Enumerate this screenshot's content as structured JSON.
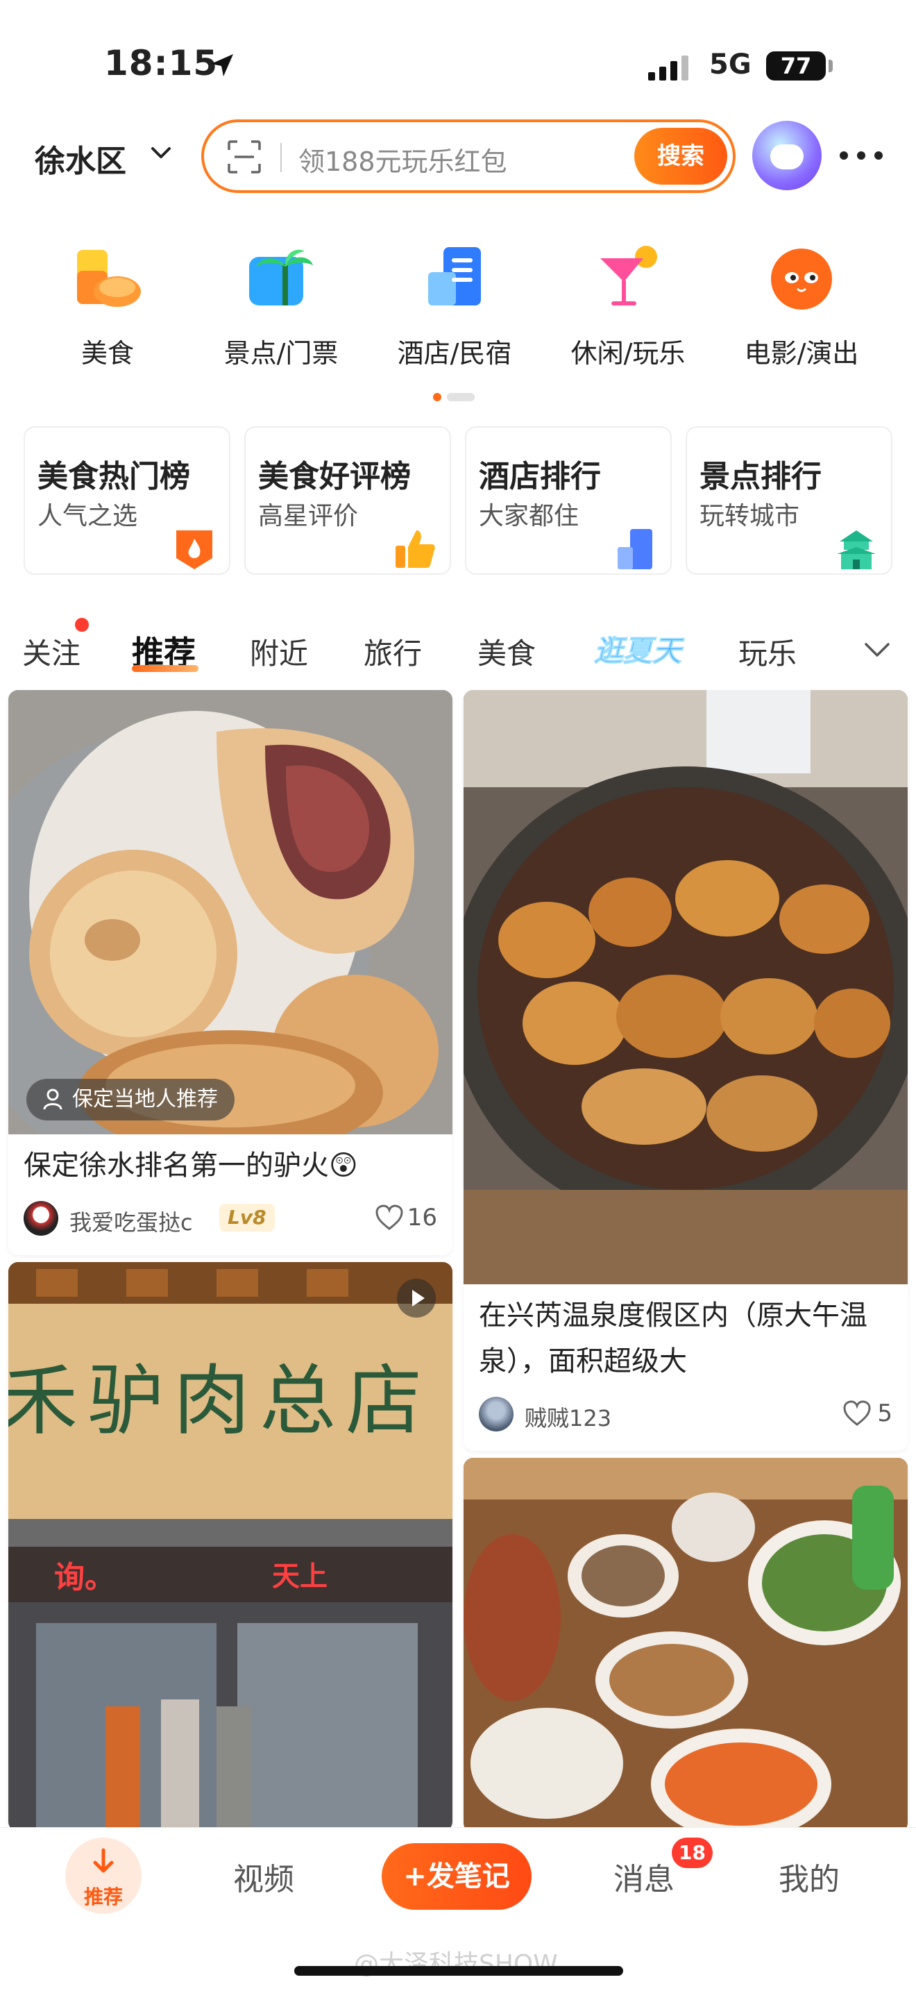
{
  "status_bar": {
    "time": "18:15",
    "network": "5G",
    "battery": "77"
  },
  "header": {
    "district": "徐水区",
    "search_placeholder": "领188元玩乐红包",
    "search_button": "搜索"
  },
  "categories": [
    {
      "label": "美食",
      "icon": "food-icon"
    },
    {
      "label": "景点/门票",
      "icon": "scenic-icon"
    },
    {
      "label": "酒店/民宿",
      "icon": "hotel-icon"
    },
    {
      "label": "休闲/玩乐",
      "icon": "cocktail-icon"
    },
    {
      "label": "电影/演出",
      "icon": "cat-movie-icon"
    }
  ],
  "rankings": [
    {
      "title": "美食热门榜",
      "subtitle": "人气之选",
      "icon": "flame-icon"
    },
    {
      "title": "美食好评榜",
      "subtitle": "高星评价",
      "icon": "thumbs-up-icon"
    },
    {
      "title": "酒店排行",
      "subtitle": "大家都住",
      "icon": "building-icon"
    },
    {
      "title": "景点排行",
      "subtitle": "玩转城市",
      "icon": "pagoda-icon"
    }
  ],
  "tabs": [
    "关注",
    "推荐",
    "附近",
    "旅行",
    "美食",
    "逛夏天",
    "玩乐"
  ],
  "active_tab": "推荐",
  "feed": [
    {
      "tag": "保定当地人推荐",
      "title": "保定徐水排名第一的驴火😲",
      "user": "我爱吃蛋挞c",
      "level": "Lv8",
      "likes": "16"
    },
    {
      "title_line1": "在兴芮温泉度假区内（原大午温",
      "title_line2": "泉），面积超级大",
      "user": "贼贼123",
      "likes": "5"
    },
    {
      "sign_text": "禾驴肉总店",
      "sign_left": "询。",
      "sign_right": "天上"
    },
    {}
  ],
  "bottom_nav": {
    "recommend": "推荐",
    "video": "视频",
    "post": "+发笔记",
    "messages": "消息",
    "messages_badge": "18",
    "mine": "我的"
  },
  "watermark": "@大泽科技SHOW",
  "colors": {
    "accent": "#ff6a1a",
    "badge": "#ff3b2f",
    "summer_tab": "#2e9bff"
  }
}
